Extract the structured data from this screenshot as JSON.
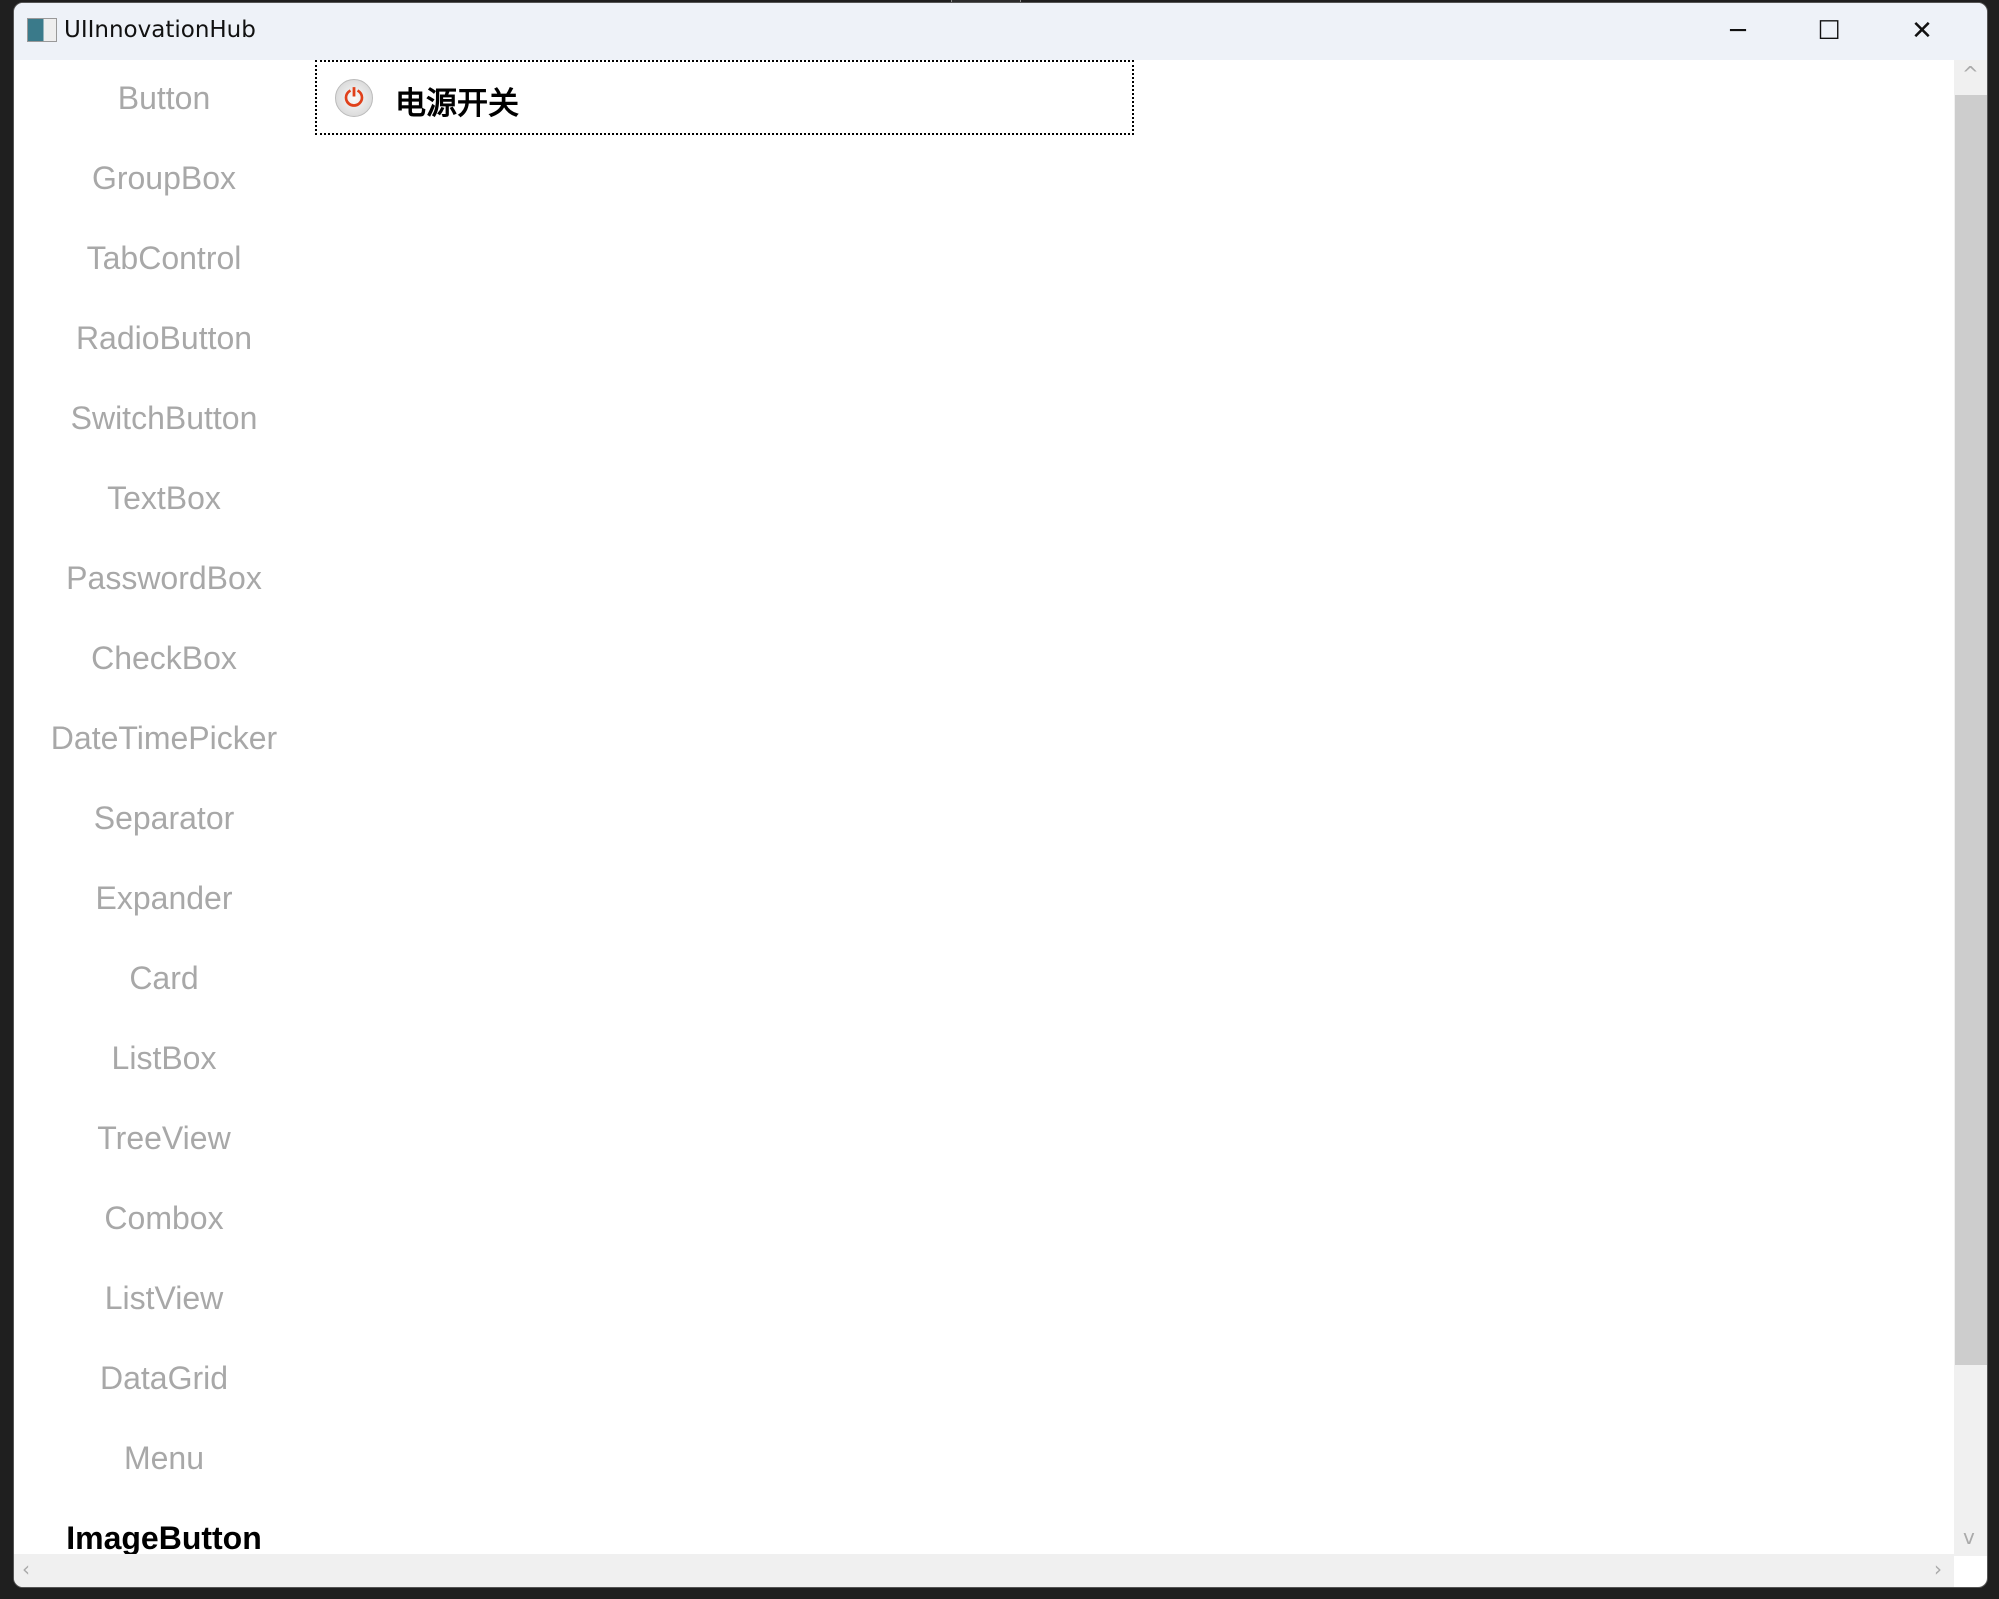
{
  "window": {
    "title": "UIInnovationHub",
    "minimize": "─",
    "maximize": "☐",
    "close": "✕"
  },
  "sidebar": {
    "items": [
      {
        "label": "Button"
      },
      {
        "label": "GroupBox"
      },
      {
        "label": "TabControl"
      },
      {
        "label": "RadioButton"
      },
      {
        "label": "SwitchButton"
      },
      {
        "label": "TextBox"
      },
      {
        "label": "PasswordBox"
      },
      {
        "label": "CheckBox"
      },
      {
        "label": "DateTimePicker"
      },
      {
        "label": "Separator"
      },
      {
        "label": "Expander"
      },
      {
        "label": "Card"
      },
      {
        "label": "ListBox"
      },
      {
        "label": "TreeView"
      },
      {
        "label": "Combox"
      },
      {
        "label": "ListView"
      },
      {
        "label": "DataGrid"
      },
      {
        "label": "Menu"
      },
      {
        "label": "ImageButton",
        "active": true
      }
    ]
  },
  "content": {
    "image_button": {
      "icon": "power-icon",
      "label": "电源开关"
    }
  },
  "scroll": {
    "up": "^",
    "down": "v",
    "left": "‹",
    "right": "›"
  }
}
